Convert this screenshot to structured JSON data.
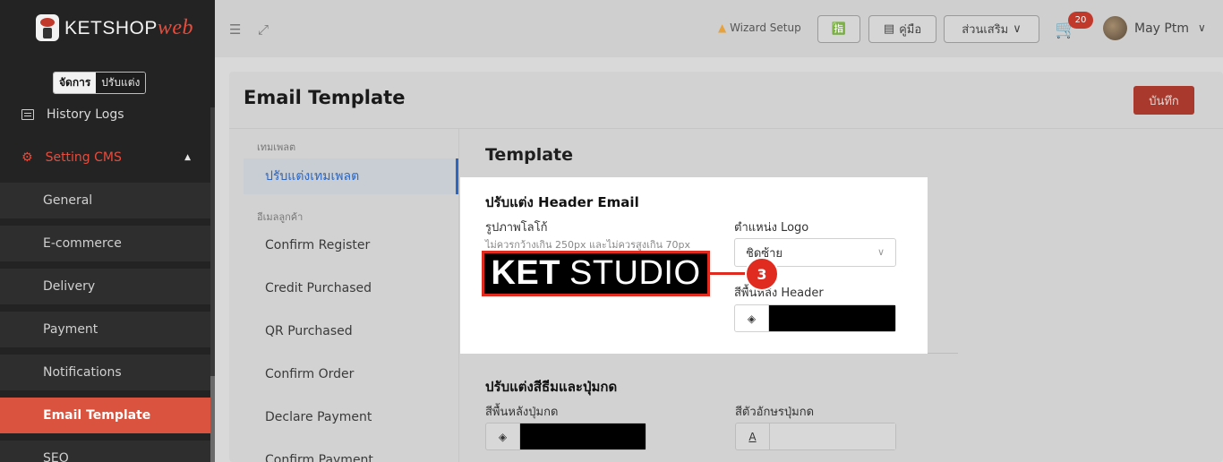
{
  "brand": {
    "name": "KETSHOP",
    "suffix": "web"
  },
  "mode_toggle": {
    "manage": "จัดการ",
    "customize": "ปรับแต่ง"
  },
  "sidebar": {
    "history": "History Logs",
    "cms": "Setting CMS",
    "sub_items": [
      "General",
      "E-commerce",
      "Delivery",
      "Payment",
      "Notifications",
      "Email Template",
      "SEO"
    ]
  },
  "topbar": {
    "wizard": "Wizard Setup",
    "lang_button": "🈯",
    "manual": "คู่มือ",
    "addons": "ส่วนเสริม",
    "cart_count": "20",
    "user": "May Ptm"
  },
  "page": {
    "title": "Email Template",
    "save": "บันทึก"
  },
  "template_nav": {
    "group1": "เทมเพลต",
    "customize": "ปรับแต่งเทมเพลต",
    "group2": "อีเมลลูกค้า",
    "items": [
      "Confirm Register",
      "Credit Purchased",
      "QR Purchased",
      "Confirm Order",
      "Declare Payment",
      "Confirm Payment"
    ]
  },
  "template": {
    "title": "Template",
    "header": {
      "title": "ปรับแต่ง Header Email",
      "logo_label": "รูปภาพโลโก้",
      "logo_hint": "ไม่ควรกว้างเกิน 250px และไม่ควรสูงเกิน 70px",
      "logo_bold": "KET",
      "logo_rest": "STUDIO",
      "position_label": "ตำแหน่ง Logo",
      "position_value": "ชิดซ้าย",
      "bg_label": "สีพื้นหลัง Header"
    },
    "buttons": {
      "title": "ปรับแต่งสีธีมและปุ่มกด",
      "bg_label": "สีพื้นหลังปุ่มกด",
      "text_label": "สีตัวอักษรปุ่มกด"
    }
  },
  "callout_number": "3",
  "colors": {
    "accent": "#e02b20",
    "brand_red": "#d9533f",
    "link_blue": "#2b66c2"
  }
}
